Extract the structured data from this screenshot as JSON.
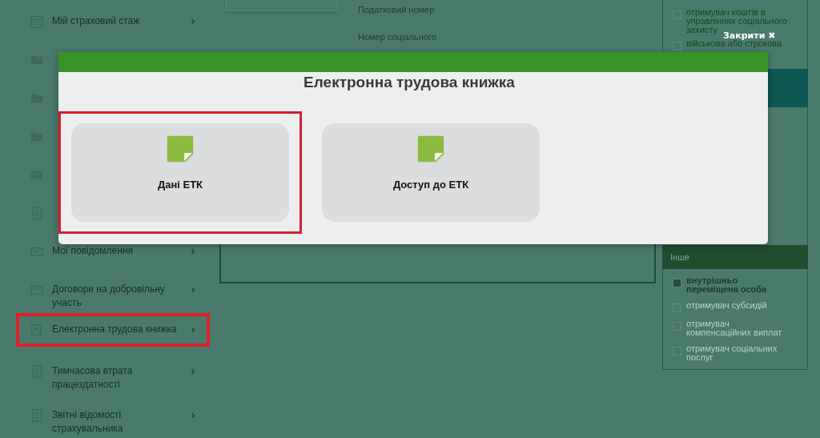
{
  "sidebar": {
    "items": [
      {
        "label": "Мій страховий стаж",
        "highlighted": false
      },
      {
        "highlighted": false
      },
      {
        "highlighted": false
      },
      {
        "highlighted": false
      },
      {
        "highlighted": false
      },
      {
        "highlighted": false
      },
      {
        "label": "Мої повідомлення",
        "highlighted": false
      },
      {
        "label": "Договори на добровільну участь",
        "highlighted": false
      },
      {
        "label": "Електронна трудова книжка",
        "highlighted": true
      },
      {
        "label": "Тимчасова втрата працездатності",
        "highlighted": false
      },
      {
        "label": "Звітні відомості страхувальника",
        "highlighted": false
      }
    ]
  },
  "profile": {
    "fields": [
      "Податковий номер",
      "Номер соціального"
    ]
  },
  "right_panel": {
    "items": [
      {
        "label": "отримувач коштів в управліннях соціального захисту",
        "selected": false
      },
      {
        "label": "військова або строкова",
        "selected": false
      }
    ],
    "section": {
      "title": "Інше",
      "items": [
        {
          "label": "внутрішньо переміщена особа",
          "selected": true
        },
        {
          "label": "отримувач субсидій",
          "selected": false
        },
        {
          "label": "отримувач компенсаційних виплат",
          "selected": false
        },
        {
          "label": "отримувач соціальних послуг",
          "selected": false
        }
      ]
    }
  },
  "close_button": {
    "label": "Закрити",
    "icon": "✖"
  },
  "modal": {
    "title": "Електронна трудова книжка",
    "cards": [
      {
        "label": "Дані ЕТК",
        "highlighted": true
      },
      {
        "label": "Доступ до ЕТК",
        "highlighted": false
      }
    ]
  }
}
